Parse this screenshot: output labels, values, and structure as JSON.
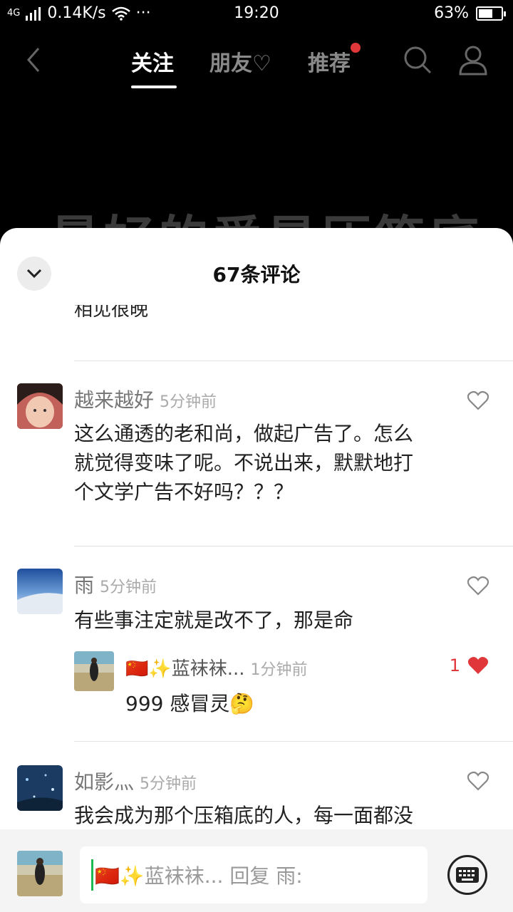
{
  "status_bar": {
    "network": "4G",
    "speed": "0.14K/s",
    "more": "···",
    "time": "19:20",
    "battery_percent": "63%",
    "battery_level": 0.63
  },
  "nav": {
    "tabs": [
      {
        "label": "关注",
        "active": true
      },
      {
        "label": "朋友♡",
        "active": false
      },
      {
        "label": "推荐",
        "active": false,
        "badge": true
      }
    ]
  },
  "video": {
    "overlay_text": "最好的爱是压箱底"
  },
  "sheet": {
    "title": "67条评论",
    "cut_text": "相见很晚"
  },
  "comments": [
    {
      "name": "越来越好",
      "time": "5分钟前",
      "text": "这么通透的老和尚，做起广告了。怎么就觉得变味了呢。不说出来，默默地打个文学广告不好吗？？？",
      "lines": [
        "这么通透的老和尚，做起广告了。怎么",
        "就觉得变味了呢。不说出来，默默地打",
        "个文学广告不好吗？？？"
      ]
    },
    {
      "name": "雨",
      "time": "5分钟前",
      "text": "有些事注定就是改不了，那是命",
      "reply": {
        "name": "🇨🇳✨蓝袜袜...",
        "time": "1分钟前",
        "text": "999 感冒灵🤔",
        "likes": "1"
      }
    },
    {
      "name": "如影灬",
      "time": "5分钟前",
      "text": "我会成为那个压箱底的人，每一面都没"
    }
  ],
  "bottom_bar": {
    "placeholder": "🇨🇳✨蓝袜袜... 回复 雨:"
  },
  "colors": {
    "accent_red": "#e0373a",
    "caret_green": "#1db954"
  }
}
